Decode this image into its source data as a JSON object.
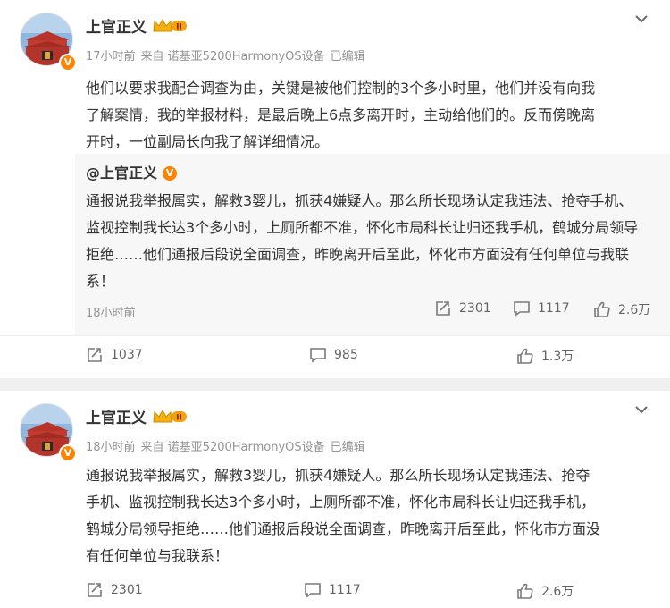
{
  "posts": [
    {
      "author": "上官正义",
      "vip_level": "II",
      "time": "17小时前",
      "source": "来自 诺基亚5200HarmonyOS设备",
      "edited": "已编辑",
      "text": [
        "他们以要求我配合调查为由，关键是被他们控制的3个多小时里，他们并没有向我",
        "了解案情，我的举报材料，是最后晚上6点多离开时，主动给他们的。反而傍晚离",
        "开时，一位副局长向我了解详细情况。"
      ],
      "repost": {
        "author": "@上官正义",
        "text": [
          "通报说我举报属实，解救3婴儿，抓获4嫌疑人。那么所长现场认定我违法、抢夺手机、",
          "监视控制我长达3个多小时，上厕所都不准，怀化市局科长让归还我手机，鹤城分局领导",
          "拒绝……他们通报后段说全面调查，昨晚离开后至此，怀化市方面没有任何单位与我联",
          "系！"
        ],
        "time": "18小时前",
        "reposts": "2301",
        "comments": "1117",
        "likes": "2.6万"
      },
      "reposts": "1037",
      "comments": "985",
      "likes": "1.3万"
    },
    {
      "author": "上官正义",
      "vip_level": "II",
      "time": "18小时前",
      "source": "来自 诺基亚5200HarmonyOS设备",
      "edited": "已编辑",
      "text": [
        "通报说我举报属实，解救3婴儿，抓获4嫌疑人。那么所长现场认定我违法、抢夺",
        "手机、监视控制我长达3个多小时，上厕所都不准，怀化市局科长让归还我手机，",
        "鹤城分局领导拒绝……他们通报后段说全面调查，昨晚离开后至此，怀化市方面没",
        "有任何单位与我联系！"
      ],
      "reposts": "2301",
      "comments": "1117",
      "likes": "2.6万"
    }
  ],
  "colors": {
    "accent": "#ff8200",
    "text": "#333333",
    "meta": "#939393",
    "repost_bg": "#f7f7f7",
    "page_bg": "#f0f0f0"
  },
  "icons": {
    "avatar": "tiananmen-avatar",
    "verified": "verified-v-badge",
    "vip": "crown-vip-badge",
    "menu": "chevron-down-icon",
    "repost": "repost-icon",
    "comment": "comment-icon",
    "like": "like-icon"
  }
}
